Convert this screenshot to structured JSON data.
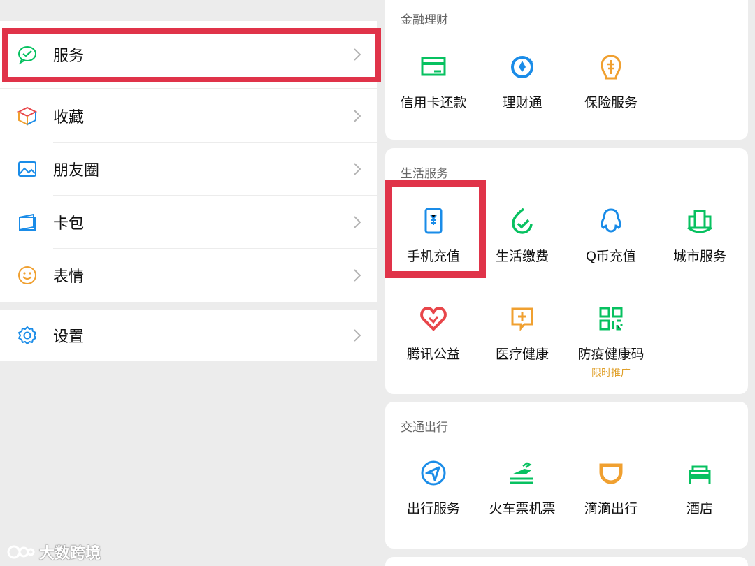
{
  "menu": {
    "services": {
      "label": "服务"
    },
    "group2": [
      {
        "label": "收藏"
      },
      {
        "label": "朋友圈"
      },
      {
        "label": "卡包"
      },
      {
        "label": "表情"
      }
    ],
    "settings": {
      "label": "设置"
    }
  },
  "finance": {
    "title": "金融理财",
    "items": [
      {
        "label": "信用卡还款",
        "icon": "credit-card-repay-icon"
      },
      {
        "label": "理财通",
        "icon": "wealth-icon"
      },
      {
        "label": "保险服务",
        "icon": "insurance-icon"
      }
    ]
  },
  "life": {
    "title": "生活服务",
    "items": [
      {
        "label": "手机充值",
        "icon": "phone-recharge-icon"
      },
      {
        "label": "生活缴费",
        "icon": "utility-payment-icon"
      },
      {
        "label": "Q币充值",
        "icon": "qcoin-icon"
      },
      {
        "label": "城市服务",
        "icon": "city-service-icon"
      },
      {
        "label": "腾讯公益",
        "icon": "charity-heart-icon"
      },
      {
        "label": "医疗健康",
        "icon": "medical-icon"
      },
      {
        "label": "防疫健康码",
        "icon": "health-code-icon",
        "promo": "限时推广"
      }
    ]
  },
  "transport": {
    "title": "交通出行",
    "items": [
      {
        "label": "出行服务",
        "icon": "travel-icon"
      },
      {
        "label": "火车票机票",
        "icon": "train-plane-icon"
      },
      {
        "label": "滴滴出行",
        "icon": "didi-icon"
      },
      {
        "label": "酒店",
        "icon": "hotel-icon"
      }
    ]
  },
  "watermark": {
    "text": "大数跨境"
  },
  "colors": {
    "highlight": "#e03349",
    "green": "#07c160",
    "blue": "#1a8ce8",
    "orange": "#f0a030",
    "red": "#e8464a"
  }
}
